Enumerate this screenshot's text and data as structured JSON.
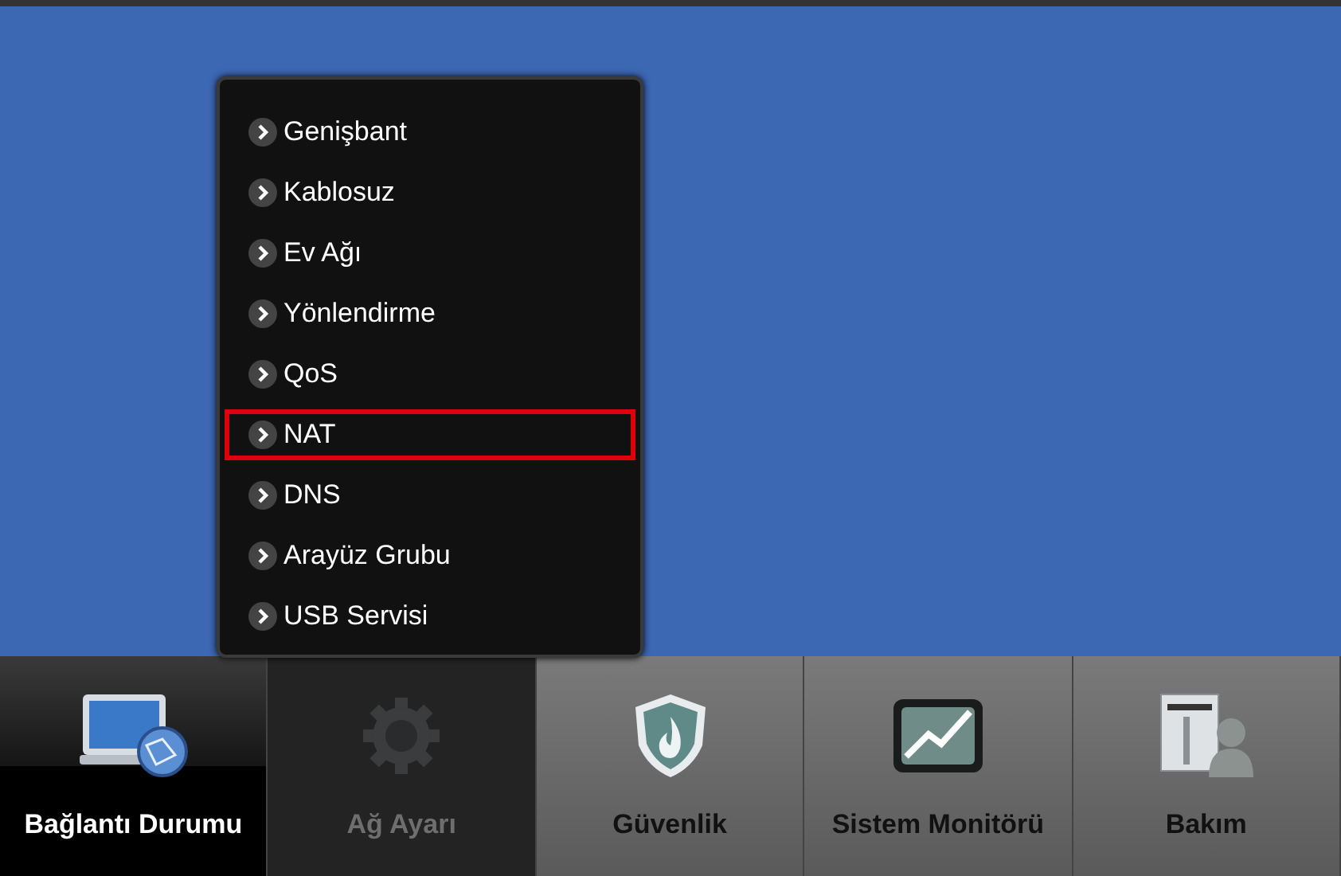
{
  "menu": {
    "items": [
      {
        "label": "Genişbant",
        "highlighted": false
      },
      {
        "label": "Kablosuz",
        "highlighted": false
      },
      {
        "label": "Ev Ağı",
        "highlighted": false
      },
      {
        "label": "Yönlendirme",
        "highlighted": false
      },
      {
        "label": "QoS",
        "highlighted": false
      },
      {
        "label": "NAT",
        "highlighted": true
      },
      {
        "label": "DNS",
        "highlighted": false
      },
      {
        "label": "Arayüz Grubu",
        "highlighted": false
      },
      {
        "label": "USB Servisi",
        "highlighted": false
      }
    ]
  },
  "nav": [
    {
      "label": "Bağlantı Durumu",
      "kind": "monitor",
      "selected": true,
      "expanded": false
    },
    {
      "label": "Ağ Ayarı",
      "kind": "gear",
      "selected": false,
      "expanded": true
    },
    {
      "label": "Güvenlik",
      "kind": "shield",
      "selected": false,
      "expanded": false
    },
    {
      "label": "Sistem Monitörü",
      "kind": "chart",
      "selected": false,
      "expanded": false
    },
    {
      "label": "Bakım",
      "kind": "maintenance",
      "selected": false,
      "expanded": false
    }
  ]
}
